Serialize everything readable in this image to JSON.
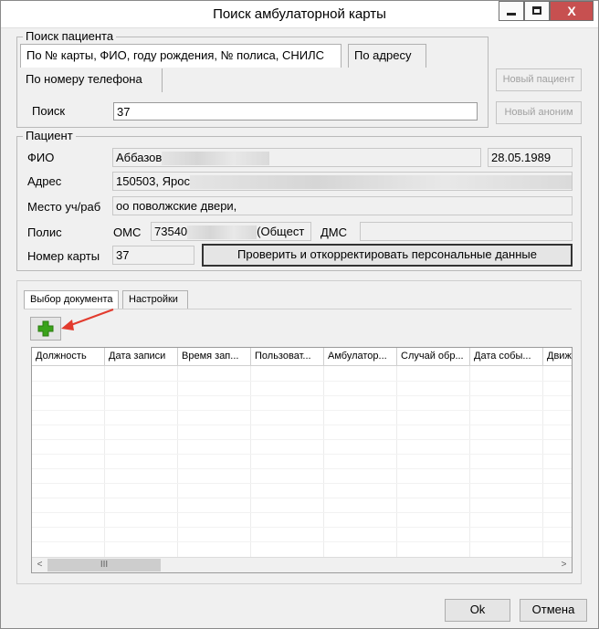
{
  "window": {
    "title": "Поиск амбулаторной карты",
    "close_glyph": "X"
  },
  "search": {
    "group_title": "Поиск пациента",
    "tabs": [
      {
        "label": "По № карты, ФИО, году рождения, № полиса, СНИЛС"
      },
      {
        "label": "По адресу"
      },
      {
        "label": "По номеру телефона"
      }
    ],
    "search_label": "Поиск",
    "search_value": "37",
    "new_patient_label": "Новый пациент",
    "new_anon_label": "Новый аноним"
  },
  "patient": {
    "group_title": "Пациент",
    "fio_label": "ФИО",
    "fio_value": "Аббазов",
    "birth_date": "28.05.1989",
    "address_label": "Адрес",
    "address_value": "150503, Ярос",
    "workplace_label": "Место уч/раб",
    "workplace_value": "оо поволжские двери,",
    "policy_label": "Полис",
    "oms_label": "ОМС",
    "oms_value_start": "73540",
    "oms_value_end": "(Общест",
    "dms_label": "ДМС",
    "card_number_label": "Номер карты",
    "card_number_value": "37",
    "verify_button": "Проверить и откорректировать персональные данные"
  },
  "documents": {
    "tabs": [
      {
        "label": "Выбор документа"
      },
      {
        "label": "Настройки"
      }
    ],
    "columns": [
      "Должность",
      "Дата записи",
      "Время зап...",
      "Пользоват...",
      "Амбулатор...",
      "Случай обр...",
      "Дата собы...",
      "Движ"
    ],
    "scroll_left": "<",
    "scroll_right": ">",
    "scroll_thumb": "III"
  },
  "footer": {
    "ok_label": "Ok",
    "cancel_label": "Отмена"
  },
  "colors": {
    "add_icon": "#3aa31a",
    "arrow_annotation": "#e23b2e"
  }
}
